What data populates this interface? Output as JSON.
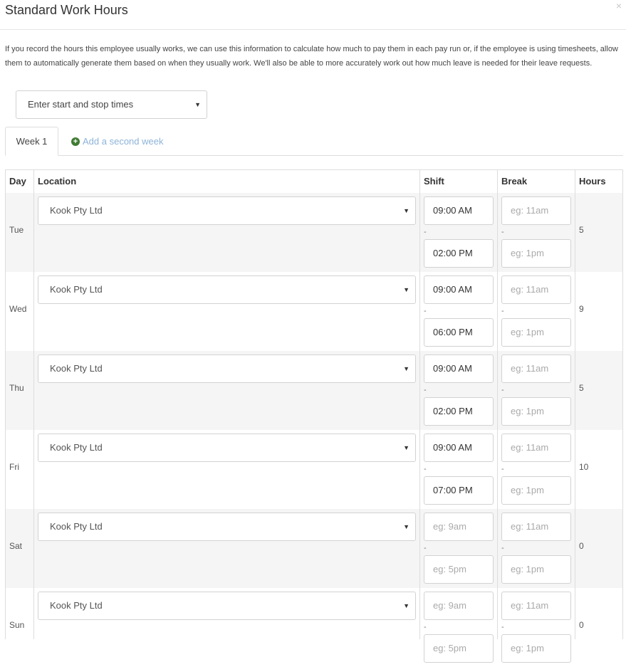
{
  "modal": {
    "title": "Standard Work Hours",
    "close_label": "×",
    "intro": "If you record the hours this employee usually works, we can use this information to calculate how much to pay them in each pay run or, if the employee is using timesheets, allow them to automatically generate them based on when they usually work. We'll also be able to more accurately work out how much leave is needed for their leave requests."
  },
  "mode_select": {
    "value": "Enter start and stop times"
  },
  "tabs": {
    "week1": "Week 1",
    "add_week": "Add a second week"
  },
  "table": {
    "headers": {
      "day": "Day",
      "location": "Location",
      "shift": "Shift",
      "break": "Break",
      "hours": "Hours"
    },
    "dash": "-",
    "rows": [
      {
        "day": "Tue",
        "location": "Kook Pty Ltd",
        "shift_start": "09:00 AM",
        "shift_end": "02:00 PM",
        "break_start": "eg: 11am",
        "break_end": "eg: 1pm",
        "hours": "5"
      },
      {
        "day": "Wed",
        "location": "Kook Pty Ltd",
        "shift_start": "09:00 AM",
        "shift_end": "06:00 PM",
        "break_start": "eg: 11am",
        "break_end": "eg: 1pm",
        "hours": "9"
      },
      {
        "day": "Thu",
        "location": "Kook Pty Ltd",
        "shift_start": "09:00 AM",
        "shift_end": "02:00 PM",
        "break_start": "eg: 11am",
        "break_end": "eg: 1pm",
        "hours": "5"
      },
      {
        "day": "Fri",
        "location": "Kook Pty Ltd",
        "shift_start": "09:00 AM",
        "shift_end": "07:00 PM",
        "break_start": "eg: 11am",
        "break_end": "eg: 1pm",
        "hours": "10"
      },
      {
        "day": "Sat",
        "location": "Kook Pty Ltd",
        "shift_start": "eg: 9am",
        "shift_end": "eg: 5pm",
        "break_start": "eg: 11am",
        "break_end": "eg: 1pm",
        "hours": "0"
      },
      {
        "day": "Sun",
        "location": "Kook Pty Ltd",
        "shift_start": "eg: 9am",
        "shift_end": "eg: 5pm",
        "break_start": "eg: 11am",
        "break_end": "eg: 1pm",
        "hours": "0"
      }
    ]
  }
}
